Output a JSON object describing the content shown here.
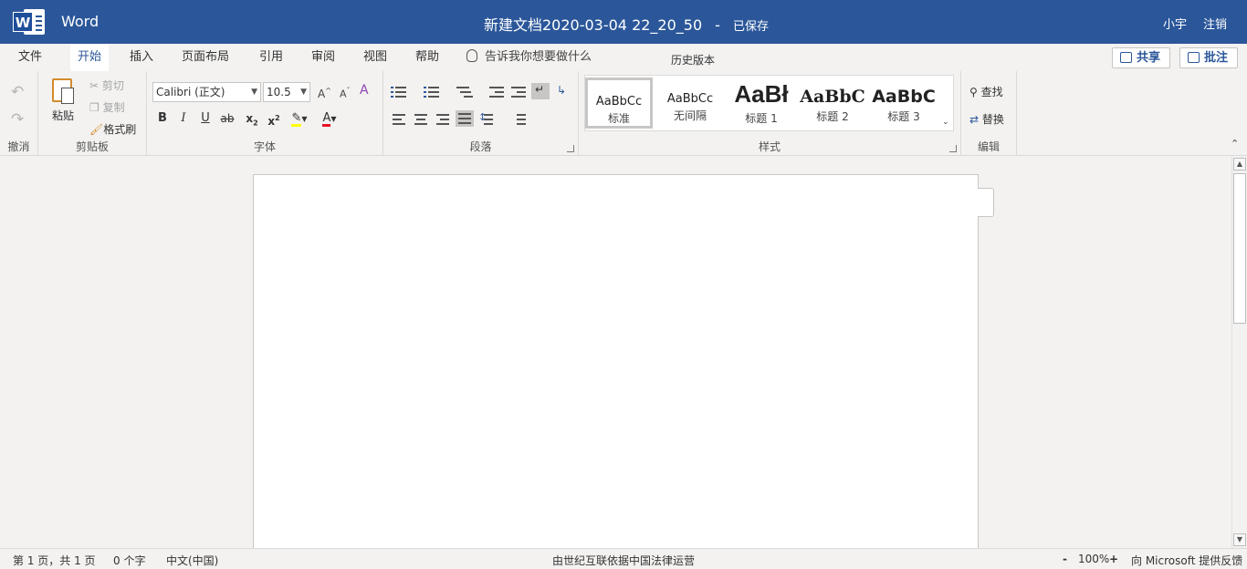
{
  "titlebar": {
    "app_name": "Word",
    "doc_name": "新建文档2020-03-04 22_20_50",
    "separator": "-",
    "save_status": "已保存",
    "user": "小宇",
    "logout": "注销"
  },
  "tabs": [
    {
      "label": "文件"
    },
    {
      "label": "开始"
    },
    {
      "label": "插入"
    },
    {
      "label": "页面布局"
    },
    {
      "label": "引用"
    },
    {
      "label": "审阅"
    },
    {
      "label": "视图"
    },
    {
      "label": "帮助"
    }
  ],
  "tell_me": "告诉我你想要做什么",
  "history": "历史版本",
  "share_label": "共享",
  "comment_label": "批注",
  "ribbon": {
    "undo_group": "撤消",
    "clipboard": {
      "label": "剪贴板",
      "paste": "粘贴",
      "cut": "剪切",
      "copy": "复制",
      "format_painter": "格式刷"
    },
    "font": {
      "label": "字体",
      "family": "Calibri (正文)",
      "size": "10.5"
    },
    "paragraph": {
      "label": "段落"
    },
    "styles": {
      "label": "样式",
      "items": [
        {
          "sample": "AaBbCc",
          "name": "标准"
        },
        {
          "sample": "AaBbCc",
          "name": "无间隔"
        },
        {
          "sample": "AaBł",
          "name": "标题 1"
        },
        {
          "sample": "AaBbC",
          "name": "标题 2"
        },
        {
          "sample": "AaBbC",
          "name": "标题 3"
        }
      ]
    },
    "editing": {
      "label": "编辑",
      "find": "查找",
      "replace": "替换"
    }
  },
  "statusbar": {
    "page": "第 1 页，共 1 页",
    "words": "0 个字",
    "language": "中文(中国)",
    "operator": "由世纪互联依据中国法律运营",
    "zoom_out": "-",
    "zoom": "100%",
    "zoom_in": "+",
    "feedback": "向 Microsoft 提供反馈"
  },
  "colors": {
    "brand": "#2b579a",
    "highlight": "#ffff00",
    "font_color": "#e81123"
  }
}
